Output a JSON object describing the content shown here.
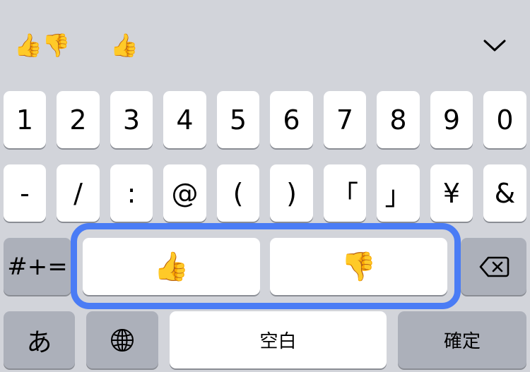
{
  "suggestions": [
    {
      "text": "👍👎"
    },
    {
      "text": "👍"
    }
  ],
  "rows": {
    "numbers": [
      "1",
      "2",
      "3",
      "4",
      "5",
      "6",
      "7",
      "8",
      "9",
      "0"
    ],
    "symbols": [
      "-",
      "/",
      ":",
      "@",
      "(",
      ")",
      "「",
      "」",
      "¥",
      "&"
    ]
  },
  "row3": {
    "symbols_toggle_label": "#+=",
    "thumbs_up": "👍",
    "thumbs_down": "👎"
  },
  "row4": {
    "hiragana_label": "あ",
    "space_label": "空白",
    "confirm_label": "確定"
  },
  "icons": {
    "globe": "globe-icon",
    "backspace": "delete-icon",
    "dismiss": "chevron-down-icon"
  },
  "colors": {
    "keyboard_bg": "#d2d4da",
    "key_bg": "#ffffff",
    "function_key_bg": "#acb0ba",
    "highlight_border": "#4a7cf5"
  }
}
